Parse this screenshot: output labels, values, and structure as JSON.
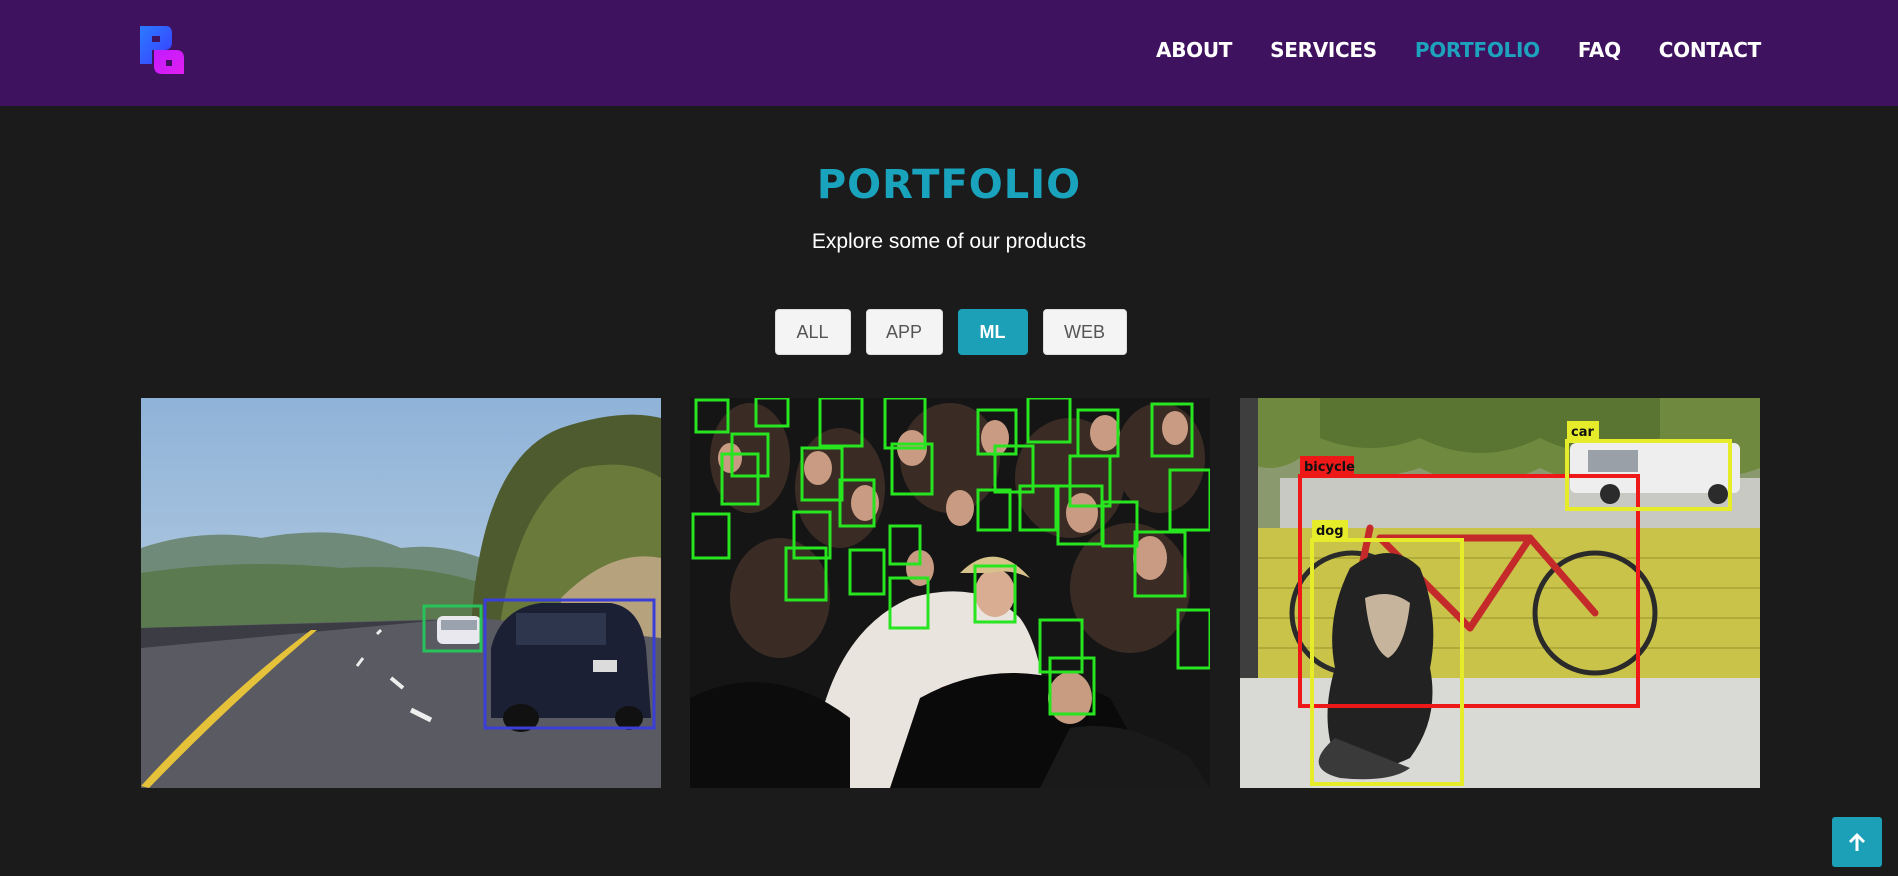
{
  "header": {
    "logo_icon": "pd-logo-icon",
    "nav": [
      {
        "label": "ABOUT",
        "active": false
      },
      {
        "label": "SERVICES",
        "active": false
      },
      {
        "label": "PORTFOLIO",
        "active": true
      },
      {
        "label": "FAQ",
        "active": false
      },
      {
        "label": "CONTACT",
        "active": false
      }
    ]
  },
  "portfolio": {
    "title": "PORTFOLIO",
    "subtitle": "Explore some of our products",
    "filters": [
      {
        "label": "ALL",
        "active": false
      },
      {
        "label": "APP",
        "active": false
      },
      {
        "label": "ML",
        "active": true
      },
      {
        "label": "WEB",
        "active": false
      }
    ],
    "items": [
      {
        "name": "vehicle-detection-image",
        "labels": []
      },
      {
        "name": "face-detection-image",
        "labels": []
      },
      {
        "name": "object-detection-image",
        "labels": [
          "car",
          "bicycle",
          "dog"
        ]
      }
    ]
  },
  "back_to_top_icon": "arrow-up-icon",
  "colors": {
    "header_bg": "#3f1260",
    "accent": "#1aa3bd",
    "page_bg": "#1b1b1b"
  }
}
